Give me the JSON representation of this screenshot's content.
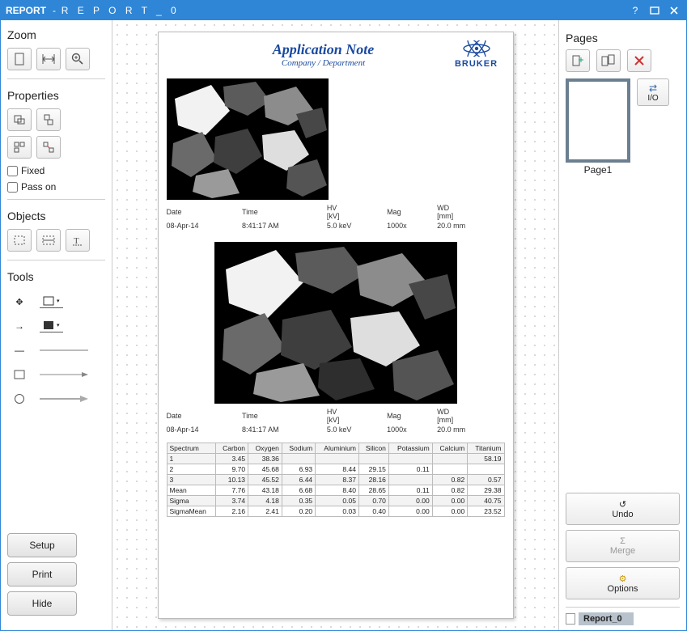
{
  "window": {
    "title_a": "REPORT",
    "title_b": "R E P O R T _ 0"
  },
  "left": {
    "zoom_label": "Zoom",
    "properties_label": "Properties",
    "fixed_label": "Fixed",
    "passon_label": "Pass on",
    "objects_label": "Objects",
    "tools_label": "Tools",
    "setup_btn": "Setup",
    "print_btn": "Print",
    "hide_btn": "Hide"
  },
  "right": {
    "pages_label": "Pages",
    "io_label": "I/O",
    "page1_label": "Page1",
    "undo_label": "Undo",
    "merge_label": "Merge",
    "options_label": "Options",
    "tab_label": "Report_0"
  },
  "report": {
    "title": "Application Note",
    "subtitle": "Company / Department",
    "brand": "BRUKER",
    "info_headers": [
      "Date",
      "Time",
      "HV\n[kV]",
      "Mag",
      "WD\n[mm]"
    ],
    "info1": [
      "08-Apr-14",
      "8:41:17 AM",
      "5.0 keV",
      "1000x",
      "20.0 mm"
    ],
    "info2": [
      "08-Apr-14",
      "8:41:17 AM",
      "5.0 keV",
      "1000x",
      "20.0 mm"
    ],
    "spectrum_headers": [
      "Spectrum",
      "Carbon",
      "Oxygen",
      "Sodium",
      "Aluminium",
      "Silicon",
      "Potassium",
      "Calcium",
      "Titanium"
    ],
    "spectrum_rows": [
      [
        "1",
        "3.45",
        "38.36",
        "",
        "",
        "",
        "",
        "",
        "58.19"
      ],
      [
        "2",
        "9.70",
        "45.68",
        "6.93",
        "8.44",
        "29.15",
        "0.11",
        "",
        ""
      ],
      [
        "3",
        "10.13",
        "45.52",
        "6.44",
        "8.37",
        "28.16",
        "",
        "0.82",
        "0.57"
      ],
      [
        "Mean",
        "7.76",
        "43.18",
        "6.68",
        "8.40",
        "28.65",
        "0.11",
        "0.82",
        "29.38"
      ],
      [
        "Sigma",
        "3.74",
        "4.18",
        "0.35",
        "0.05",
        "0.70",
        "0.00",
        "0.00",
        "40.75"
      ],
      [
        "SigmaMean",
        "2.16",
        "2.41",
        "0.20",
        "0.03",
        "0.40",
        "0.00",
        "0.00",
        "23.52"
      ]
    ]
  }
}
